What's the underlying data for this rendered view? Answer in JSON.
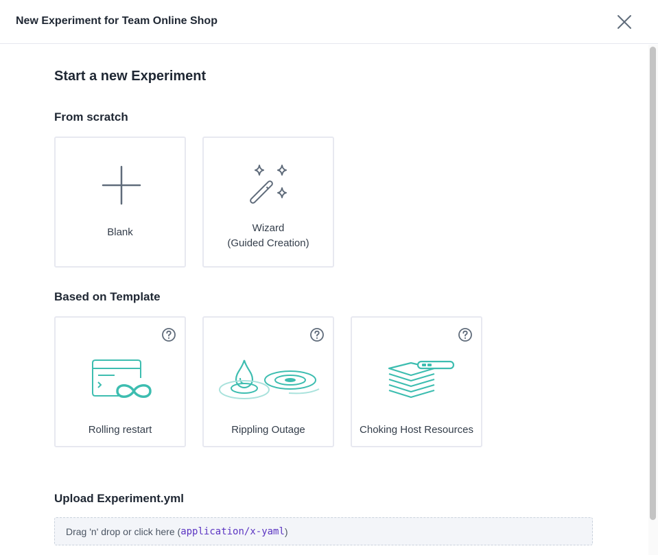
{
  "header": {
    "title": "New Experiment for Team Online Shop",
    "close_icon": "close-icon"
  },
  "main": {
    "title": "Start a new Experiment",
    "from_scratch": {
      "title": "From scratch",
      "cards": [
        {
          "label": "Blank",
          "icon": "plus-icon"
        },
        {
          "label_line1": "Wizard",
          "label_line2": "(Guided Creation)",
          "icon": "magic-wand-icon"
        }
      ]
    },
    "template": {
      "title": "Based on Template",
      "cards": [
        {
          "label": "Rolling restart",
          "icon": "rolling-restart-icon"
        },
        {
          "label": "Rippling Outage",
          "icon": "rippling-outage-icon"
        },
        {
          "label": "Choking Host Resources",
          "icon": "choking-host-resources-icon"
        }
      ]
    },
    "upload": {
      "title": "Upload Experiment.yml",
      "text_prefix": "Drag 'n' drop or click here (",
      "mime": "application/x-yaml",
      "text_suffix": ")"
    }
  },
  "colors": {
    "accent_teal": "#3dbdb0",
    "icon_gray": "#5f6b7a",
    "mime_purple": "#5b35c2"
  }
}
